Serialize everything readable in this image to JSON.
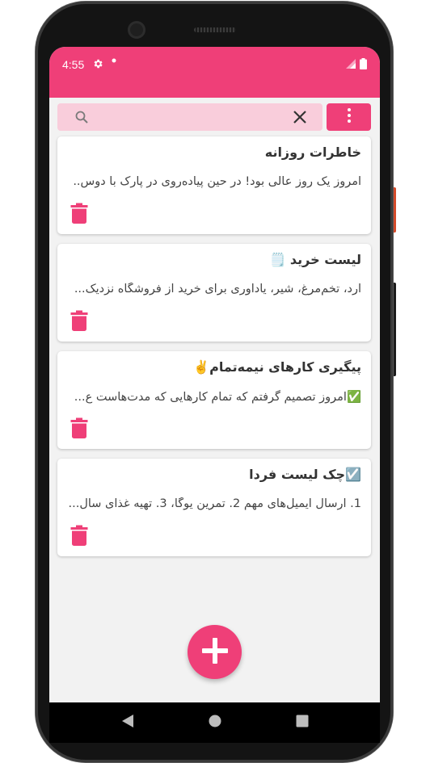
{
  "status_bar": {
    "time": "4:55",
    "icons": [
      "gear-icon",
      "dot-icon",
      "signal-icon",
      "battery-icon"
    ]
  },
  "search": {
    "value": "",
    "placeholder": ""
  },
  "notes": [
    {
      "title": "خاطرات روزانه",
      "body": "امروز یک روز عالی بود! در حین پیاده‌روی در پارک با دوس.."
    },
    {
      "title": "لیست خرید 🗒️",
      "body": "آرد، تخم‌مرغ، شیر، یادآوری برای خرید از فروشگاه نزدیک..."
    },
    {
      "title": "پیگیری کارهای نیمه‌تمام✌️",
      "body": "✅امروز تصمیم گرفتم که تمام کارهایی که مدت‌هاست ع..."
    },
    {
      "title": "☑️چک لیست فردا",
      "body": "1. ارسال ایمیل‌های مهم 2. تمرین یوگا، 3. تهیه غذای سال..."
    }
  ],
  "colors": {
    "accent": "#ef3f78",
    "search_bg": "#f9cddb",
    "background": "#f2f2f2"
  }
}
